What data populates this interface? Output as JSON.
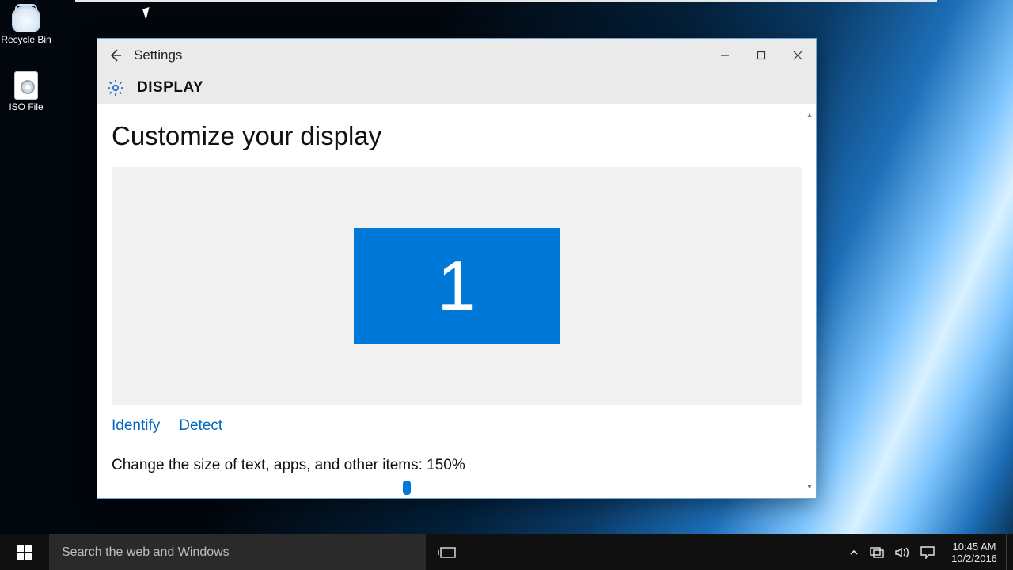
{
  "desktop_icons": {
    "recycle_bin": "Recycle Bin",
    "iso_file": "ISO File"
  },
  "window": {
    "app_title": "Settings",
    "category": "DISPLAY",
    "heading": "Customize your display",
    "monitor_number": "1",
    "identify_link": "Identify",
    "detect_link": "Detect",
    "scale_label": "Change the size of text, apps, and other items: 150%"
  },
  "taskbar": {
    "search_placeholder": "Search the web and Windows",
    "time": "10:45 AM",
    "date": "10/2/2016"
  }
}
